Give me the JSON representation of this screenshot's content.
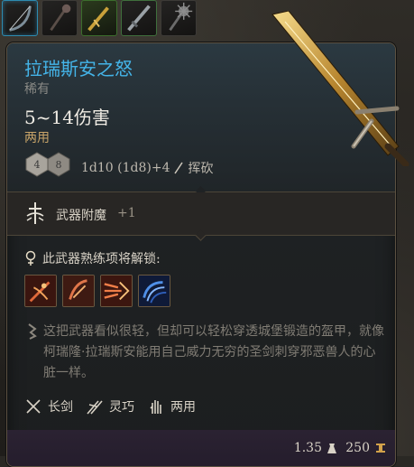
{
  "item": {
    "name": "拉瑞斯安之怒",
    "rarity": "稀有",
    "damage": "5~14伤害",
    "handedness": "两用",
    "dice": [
      "4",
      "8"
    ],
    "damage_formula": "1d10 (1d8)+4",
    "damage_type": "挥砍"
  },
  "enchantment": {
    "label": "武器附魔",
    "value": "+1"
  },
  "proficiency": {
    "label": "此武器熟练项将解锁:",
    "skills": [
      "crushing-slash",
      "swordsman-strike",
      "flourish-slash",
      "tidal-wave"
    ]
  },
  "lore": "这把武器看似很轻，但却可以轻松穿透城堡锻造的盔甲，就像柯瑞隆·拉瑞斯安能用自己威力无穷的圣剑刺穿邪恶兽人的心脏一样。",
  "properties": [
    {
      "icon": "longsword-icon",
      "label": "长剑"
    },
    {
      "icon": "finesse-icon",
      "label": "灵巧"
    },
    {
      "icon": "versatile-icon",
      "label": "两用"
    }
  ],
  "footer": {
    "weight": "1.35",
    "value": "250"
  },
  "colors": {
    "title": "#44b4e8",
    "accent": "#c8a469",
    "border": "#5c5141"
  }
}
